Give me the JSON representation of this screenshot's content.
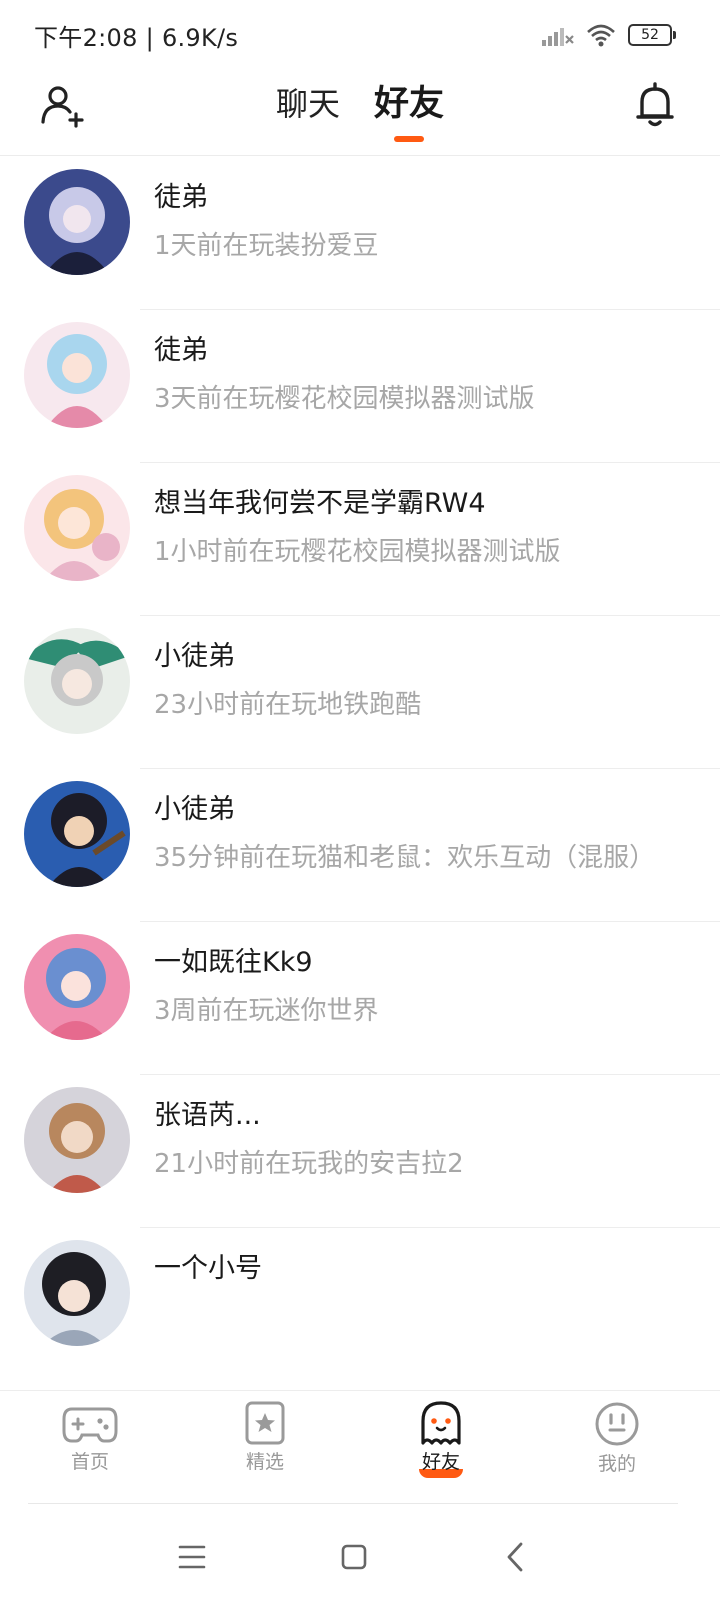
{
  "status_bar": {
    "time_speed": "下午2:08 | 6.9K/s",
    "battery": "52"
  },
  "header": {
    "tabs": [
      {
        "label": "聊天",
        "active": false
      },
      {
        "label": "好友",
        "active": true
      }
    ],
    "icons": {
      "left": "add-friend-icon",
      "right": "bell-icon"
    }
  },
  "friends": [
    {
      "name": "徒弟",
      "activity": "1天前在玩装扮爱豆",
      "avatar_colors": [
        "#3b4a8c",
        "#c8c9e8",
        "#1b1f3a"
      ]
    },
    {
      "name": "徒弟",
      "activity": "3天前在玩樱花校园模拟器测试版",
      "avatar_colors": [
        "#f3c9d8",
        "#a9d6ee",
        "#e58aa9"
      ]
    },
    {
      "name": "想当年我何尝不是学霸RW4",
      "activity": "1小时前在玩樱花校园模拟器测试版",
      "avatar_colors": [
        "#fbe6e9",
        "#f3c47c",
        "#e9b4c8"
      ]
    },
    {
      "name": "小徒弟",
      "activity": "23小时前在玩地铁跑酷",
      "avatar_colors": [
        "#e9eee9",
        "#2f8d74",
        "#c9c9c9"
      ]
    },
    {
      "name": "小徒弟",
      "activity": "35分钟前在玩猫和老鼠：欢乐互动（混服）",
      "avatar_colors": [
        "#2a5db0",
        "#1c1c28",
        "#f0d2b5"
      ]
    },
    {
      "name": "一如既往Kk9",
      "activity": "3周前在玩迷你世界",
      "avatar_colors": [
        "#f08fb0",
        "#6a8fd0",
        "#e66a8e"
      ]
    },
    {
      "name": "张语芮...",
      "activity": "21小时前在玩我的安吉拉2",
      "avatar_colors": [
        "#d5d3da",
        "#c05a4a",
        "#f1d9c6"
      ]
    },
    {
      "name": "一个小号",
      "activity": "",
      "avatar_colors": [
        "#dfe4ec",
        "#1e1e24",
        "#f5e2d6"
      ]
    }
  ],
  "bottom_nav": [
    {
      "label": "首页",
      "icon": "gamepad-icon",
      "active": false
    },
    {
      "label": "精选",
      "icon": "star-card-icon",
      "active": false
    },
    {
      "label": "好友",
      "icon": "ghost-icon",
      "active": true
    },
    {
      "label": "我的",
      "icon": "smiley-icon",
      "active": false
    }
  ],
  "colors": {
    "accent": "#ff5a12",
    "secondary_text": "#a7a7a7",
    "inactive_nav": "#999999"
  }
}
